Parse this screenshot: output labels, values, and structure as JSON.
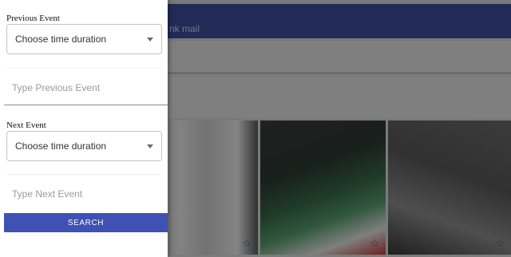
{
  "background": {
    "appbar_title": "nk mail",
    "star_glyph": "☆"
  },
  "drawer": {
    "previous_event": {
      "label": "Previous Event",
      "select_value": "Choose time duration",
      "input_placeholder": "Type Previous Event"
    },
    "next_event": {
      "label": "Next Event",
      "select_value": "Choose time duration",
      "input_placeholder": "Type Next Event"
    },
    "search_label": "Search"
  },
  "colors": {
    "primary": "#3f51b5",
    "appbar": "#3f4da0"
  }
}
